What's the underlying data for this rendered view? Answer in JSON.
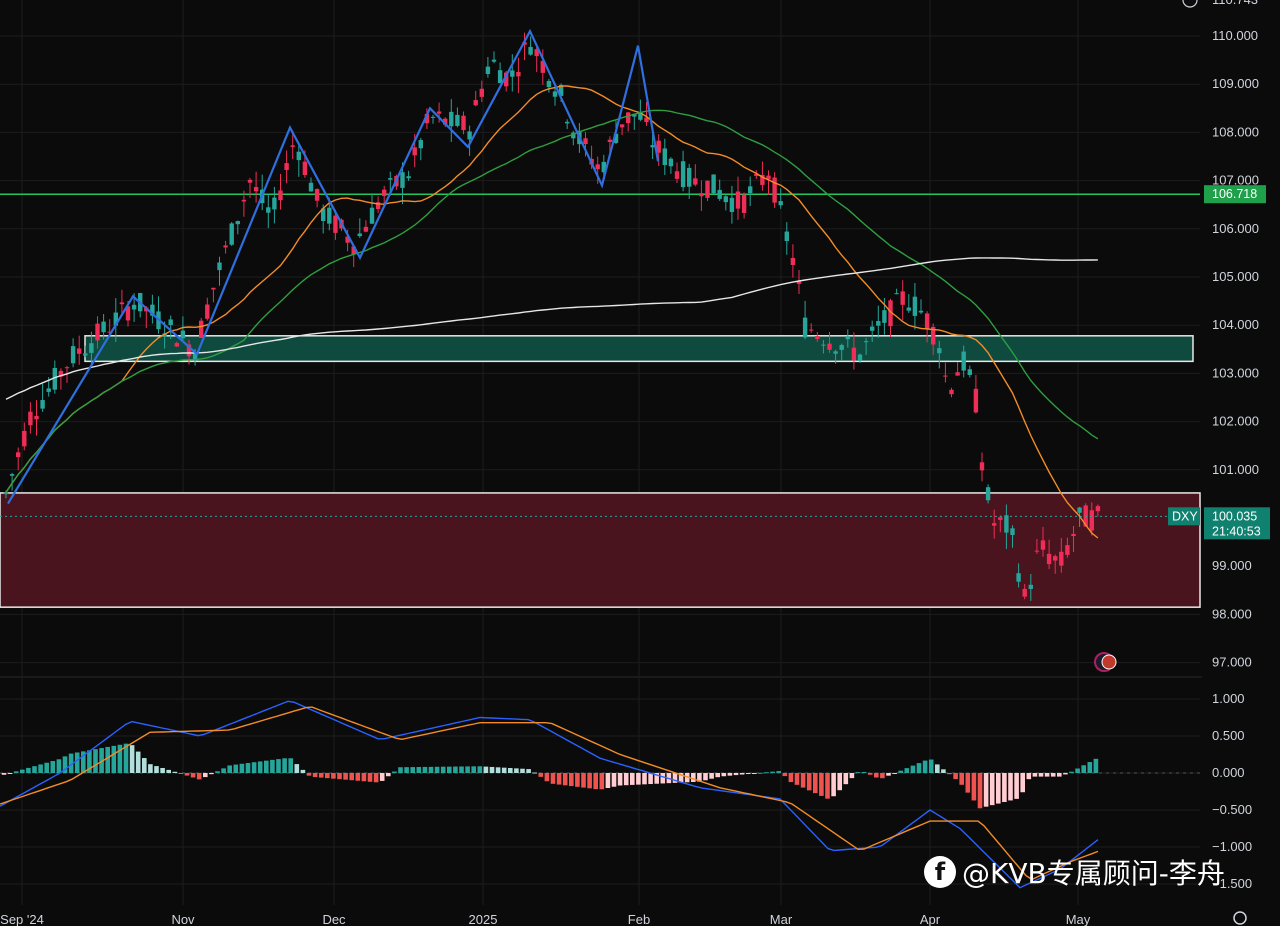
{
  "chart_data": [
    {
      "type": "candlestick",
      "symbol": "DXY",
      "last_price": "100.035",
      "countdown": "21:40:53",
      "level_label": "106.718",
      "top_partial_label": "110.743",
      "y_ticks": [
        "110.000",
        "109.000",
        "108.000",
        "107.000",
        "106.000",
        "105.000",
        "104.000",
        "103.000",
        "102.000",
        "101.000",
        "99.000",
        "98.000",
        "97.000"
      ],
      "x_labels": [
        "Sep '24",
        "Nov",
        "Dec",
        "2025",
        "Feb",
        "Mar",
        "Apr",
        "May"
      ],
      "ylim": [
        96.7,
        110.6
      ],
      "series": [
        {
          "name": "",
          "color": "#f28c28",
          "kind": "sma-short"
        },
        {
          "name": "",
          "color": "#2e9e3f",
          "kind": "sma-mid"
        },
        {
          "name": "",
          "color": "#e6e6e6",
          "kind": "sma-long"
        }
      ],
      "zones": [
        {
          "from": 103.25,
          "to": 103.78,
          "color": "#0e4a3e"
        },
        {
          "from": 98.15,
          "to": 100.52,
          "color": "#4a141e"
        }
      ],
      "horizontal_line": {
        "value": 106.718,
        "color": "#22c55e"
      }
    },
    {
      "type": "macd",
      "y_ticks": [
        "1.000",
        "0.500",
        "0.000",
        "−0.500",
        "−1.000",
        "−1.500"
      ],
      "ylim": [
        -1.6,
        1.1
      ],
      "macd_color": "#2962ff",
      "signal_color": "#f28c28"
    }
  ],
  "watermark": {
    "text": "@KVB专属顾问-李舟",
    "icon": "facebook-icon"
  },
  "icons": {
    "flag": "us-flag-icon",
    "settings": "gear-icon"
  }
}
